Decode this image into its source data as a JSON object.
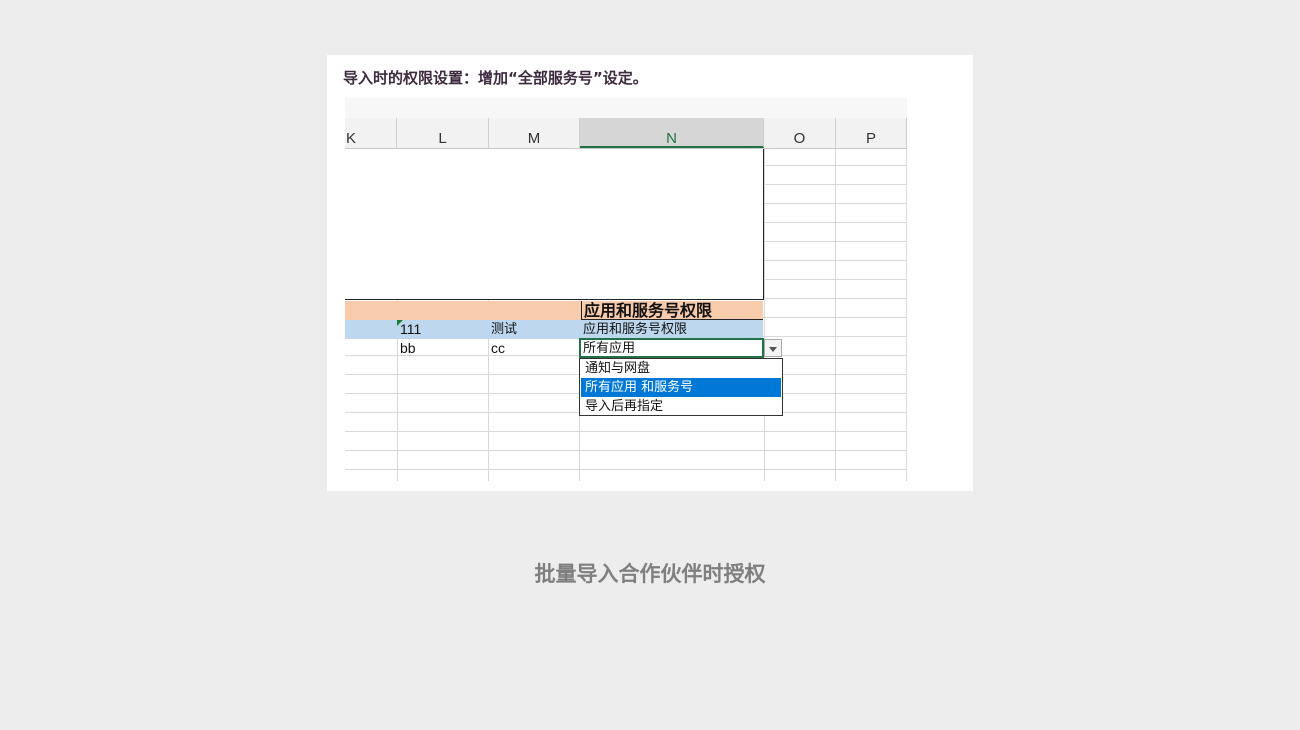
{
  "heading": "导入时的权限设置：增加“全部服务号”设定。",
  "sheet": {
    "columns": [
      "K",
      "L",
      "M",
      "N",
      "O",
      "P"
    ],
    "header_cell": "应用和服务号权限",
    "rows": [
      {
        "l": "111",
        "m": "测试",
        "n": "应用和服务号权限"
      },
      {
        "l": "bb",
        "m": "cc",
        "n": "所有应用"
      }
    ],
    "dropdown": {
      "options": [
        "通知与网盘",
        "所有应用 和服务号",
        "导入后再指定"
      ],
      "highlighted_index": 1
    }
  },
  "caption": "批量导入合作伙伴时授权",
  "colors": {
    "header_row": "#f8cbad",
    "data_row": "#bdd7ee",
    "selection": "#217346",
    "highlight": "#0078d7"
  }
}
